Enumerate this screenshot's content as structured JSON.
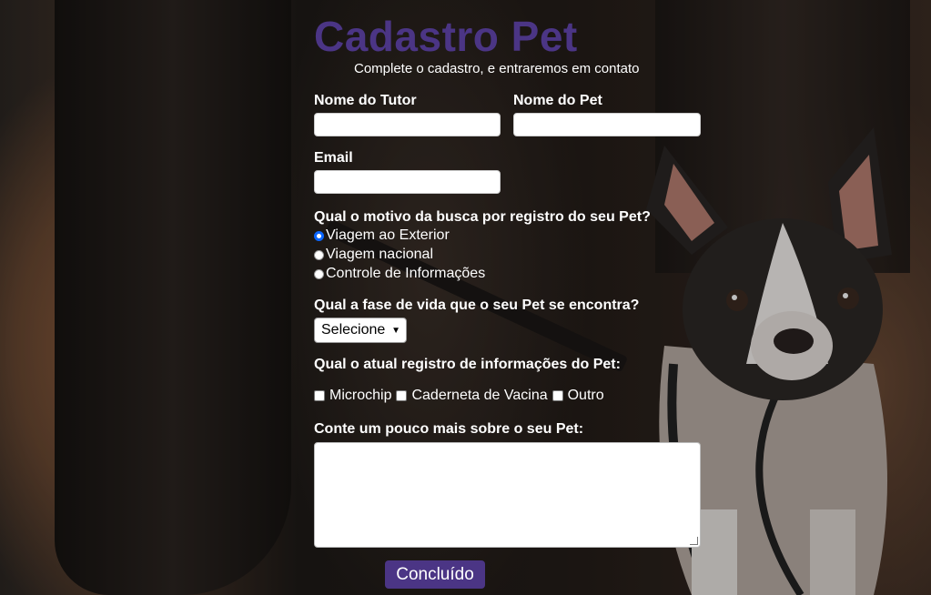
{
  "form": {
    "title": "Cadastro Pet",
    "subtitle": "Complete o cadastro, e entraremos em contato",
    "tutor_label": "Nome do Tutor",
    "tutor_value": "",
    "pet_label": "Nome do Pet",
    "pet_value": "",
    "email_label": "Email",
    "email_value": "",
    "motivo_question": "Qual o motivo da busca por registro do seu Pet?",
    "motivo_options": [
      {
        "label": "Viagem ao Exterior",
        "checked": true
      },
      {
        "label": "Viagem nacional",
        "checked": false
      },
      {
        "label": "Controle de Informações",
        "checked": false
      }
    ],
    "fase_question": "Qual a fase de vida que o seu Pet se encontra?",
    "fase_selected": "Selecione",
    "registro_question": "Qual o atual registro de informações do Pet:",
    "registro_options": [
      {
        "label": "Microchip",
        "checked": false
      },
      {
        "label": "Caderneta de Vacina",
        "checked": false
      },
      {
        "label": "Outro",
        "checked": false
      }
    ],
    "about_label": "Conte um pouco mais sobre o seu Pet:",
    "about_value": "",
    "submit_label": "Concluído"
  },
  "colors": {
    "title": "#4b3585",
    "button": "#4b3585",
    "radio_selected": "#0a66ff"
  },
  "background": {
    "image": "dog-photo-background",
    "chevron_icon": "chevron-down-icon"
  }
}
